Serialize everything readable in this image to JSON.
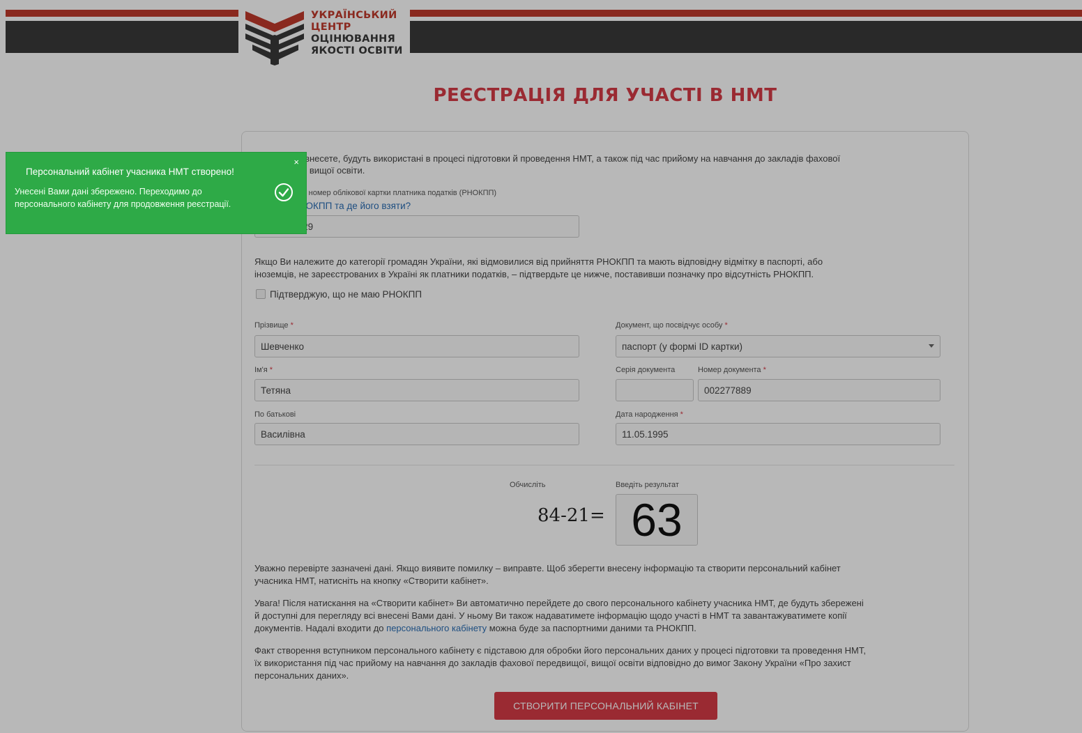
{
  "header": {
    "logo_lines": [
      "УКРАЇНСЬКИЙ",
      "ЦЕНТР",
      "ОЦІНЮВАННЯ",
      "ЯКОСТІ ОСВІТИ"
    ]
  },
  "page_title": "РЕЄСТРАЦІЯ ДЛЯ УЧАСТІ В НМТ",
  "form": {
    "intro_a": "Дані, які Ви внесете, будуть використані в процесі підготовки й проведення НМТ, а також під час прийому на навчання до закладів фахової",
    "intro_b": "передвищої, вищої освіти.",
    "rnokpp_label": "Реєстраційний номер облікової картки платника податків (РНОКПП)",
    "rnokpp_help_link": "Що таке РНОКПП та де його взяти?",
    "rnokpp_value": "3682900029",
    "no_rnokpp_note_a": "Якщо Ви належите до категорії громадян України, які відмовилися від прийняття РНОКПП та мають відповідну відмітку в паспорті, або",
    "no_rnokpp_note_b": "іноземців, не зареєстрованих в Україні як платники податків, – підтвердьте це нижче, поставивши позначку про відсутність РНОКПП.",
    "no_rnokpp_checkbox_label": "Підтверджую, що не маю РНОКПП",
    "surname_label": "Прізвище",
    "surname_value": "Шевченко",
    "name_label": "Ім'я",
    "name_value": "Тетяна",
    "patronymic_label": "По батькові",
    "patronymic_value": "Василівна",
    "doc_label": "Документ, що посвідчує особу",
    "doc_value": "паспорт (у формі ID картки)",
    "doc_series_label": "Серія документа",
    "doc_series_value": "",
    "doc_number_label": "Номер документа",
    "doc_number_value": "002277889",
    "birth_label": "Дата народження",
    "birth_value": "11.05.1995",
    "required_mark": "*",
    "captcha_label": "Обчисліть",
    "captcha_expr": "84-21=",
    "captcha_result_label": "Введіть результат",
    "captcha_result_value": "63",
    "check_a": "Уважно перевірте зазначені дані. Якщо виявите помилку – виправте. Щоб зберегти внесену інформацію та створити персональний кабінет",
    "check_b": "учасника НМТ, натисніть на кнопку «Створити кабінет».",
    "attention_a": "Увага! Після натискання на «Створити кабінет» Ви автоматично перейдете до свого персонального кабінету учасника НМТ, де будуть збережені",
    "attention_b": "й доступні для перегляду всі внесені Вами дані. У ньому Ви також надаватимете інформацію щодо участі в НМТ та завантажуватимете копії",
    "attention_c1": "документів. Надалі входити до ",
    "attention_link": "персонального кабінету",
    "attention_c2": " можна буде за паспортними даними та РНОКПП.",
    "consent_a": "Факт створення вступником персонального кабінету є підставою для обробки його персональних даних у процесі підготовки та проведення НМТ,",
    "consent_b": "їх використання під час прийому на навчання до закладів фахової передвищої, вищої освіти відповідно до вимог Закону України «Про захист",
    "consent_c": "персональних даних».",
    "submit_label": "СТВОРИТИ ПЕРСОНАЛЬНИЙ КАБІНЕТ"
  },
  "toast": {
    "title": "Персональний кабінет учасника НМТ створено!",
    "body": "Унесені Вами дані збережено. Переходимо до персонального кабінету для продовження реєстрації.",
    "close": "×",
    "icon": "check-circle-icon",
    "color": "#2eaa47"
  },
  "colors": {
    "accent_red": "#d63b46",
    "header_dark": "#3a3a3a",
    "link": "#2a6db3"
  }
}
